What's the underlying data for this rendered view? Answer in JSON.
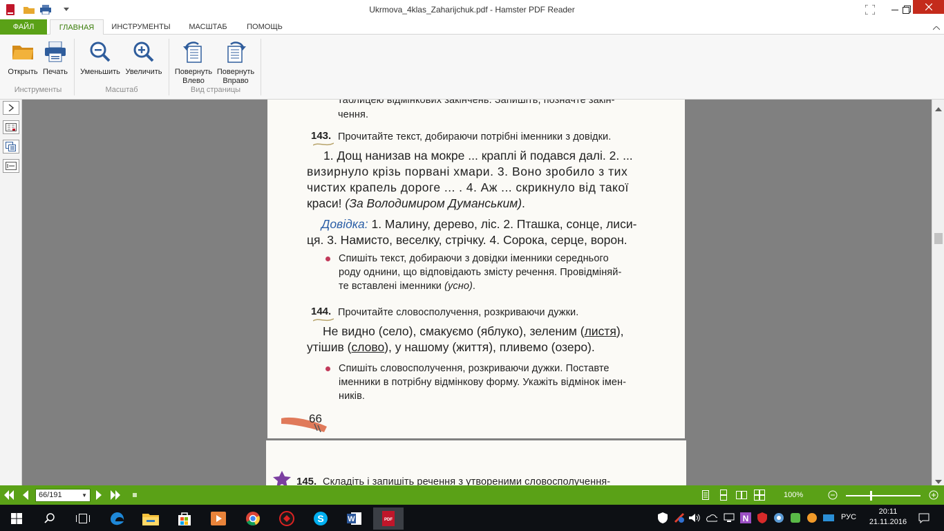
{
  "window": {
    "title": "Ukrmova_4klas_Zaharijchuk.pdf - Hamster PDF Reader"
  },
  "tabs": [
    {
      "label": "ФАЙЛ"
    },
    {
      "label": "ГЛАВНАЯ"
    },
    {
      "label": "ИНСТРУМЕНТЫ"
    },
    {
      "label": "МАСШТАБ"
    },
    {
      "label": "ПОМОЩЬ"
    }
  ],
  "ribbon": {
    "open": "Открыть",
    "print": "Печать",
    "zoom_out": "Уменьшить",
    "zoom_in": "Увеличить",
    "rotate_left_1": "Повернуть",
    "rotate_left_2": "Влево",
    "rotate_right_1": "Повернуть",
    "rotate_right_2": "Вправо",
    "group_tools": "Инструменты",
    "group_zoom": "Масштаб",
    "group_view": "Вид страницы"
  },
  "document": {
    "top_line1": "таблицею відмінкових закінчень. Запишіть, позначте закін-",
    "top_line2": "чення.",
    "ex143_num": "143.",
    "ex143_task": "Прочитайте текст, добираючи потрібні іменники з довідки.",
    "ex143_l1": "1. Дощ нанизав на мокре ... краплі й подався далі. 2. ...",
    "ex143_l2": "визирнуло крізь порвані хмари. 3. Воно зробило з тих",
    "ex143_l3": "чистих крапель дороге ... . 4. Аж ... скрикнуло від такої",
    "ex143_l4a": "краси! ",
    "ex143_l4b": "(За Володимиром Думанським)",
    "ex143_l4c": ".",
    "dovidka_label": "Довідка:",
    "dovidka_l1": " 1. Малину, дерево, ліс. 2. Пташка, сонце, лиси-",
    "dovidka_l2": "ця. 3. Намисто, веселку, стрічку. 4. Сорока, серце, ворон.",
    "b1_l1": "Спишіть текст, добираючи з довідки іменники середнього",
    "b1_l2": "роду однини, що відповідають змісту речення. Провідміняй-",
    "b1_l3a": "те вставлені іменники ",
    "b1_l3b": "(усно)",
    "b1_l3c": ".",
    "ex144_num": "144.",
    "ex144_task": "Прочитайте словосполучення, розкриваючи дужки.",
    "ex144_l1a": "Не видно (село), смакуємо (яблуко), зеленим (",
    "ex144_l1b": "листя",
    "ex144_l1c": "),",
    "ex144_l2a": "утішив (",
    "ex144_l2b": "слово",
    "ex144_l2c": "), у нашому (життя), пливемо (озеро).",
    "b2_l1": "Спишіть словосполучення, розкриваючи дужки. Поставте",
    "b2_l2": "іменники в потрібну відмінкову форму. Укажіть відмінок імен-",
    "b2_l3": "ників.",
    "page_number": "66",
    "next_num": "145.",
    "next_task": "Складіть і запишіть речення з утвореними словосполучення-"
  },
  "status": {
    "page_field": "66/191",
    "zoom": "100%"
  },
  "taskbar": {
    "lang": "РУС",
    "time": "20:11",
    "date": "21.11.2016"
  },
  "colors": {
    "accent_green": "#5aa117",
    "doc_bg": "#808080",
    "link_blue": "#2a5ea6"
  }
}
